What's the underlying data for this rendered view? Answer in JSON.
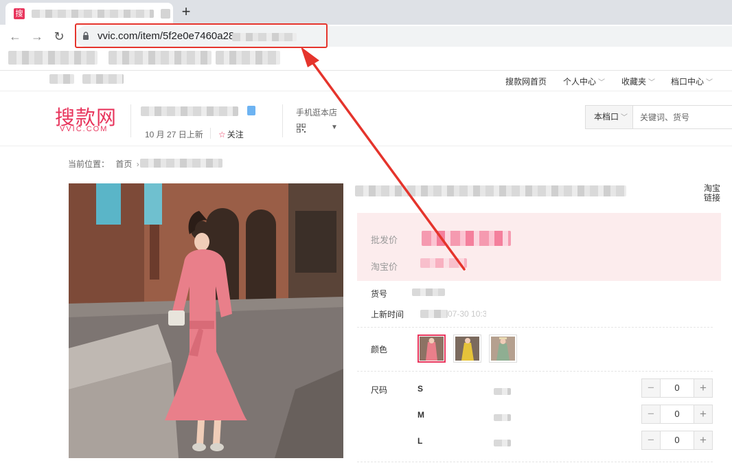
{
  "browser": {
    "tab_favicon_glyph": "搜",
    "new_tab_glyph": "+",
    "url": "vvic.com/item/5f2e0e7460a28",
    "highlight_color": "#e5342c"
  },
  "topnav": {
    "items": [
      {
        "label": "搜款网首页",
        "has_caret": false
      },
      {
        "label": "个人中心",
        "has_caret": true
      },
      {
        "label": "收藏夹",
        "has_caret": true
      },
      {
        "label": "档口中心",
        "has_caret": true
      }
    ],
    "caret_glyph": "﹀"
  },
  "header": {
    "logo_cn": "搜款网",
    "logo_en": "VVIC.COM",
    "brand_color": "#e8365d",
    "shop_date": "10 月 27 日上新",
    "follow_label": "关注",
    "mobile_store_label": "手机逛本店",
    "search_scope": "本档口",
    "search_placeholder": "关键词、货号"
  },
  "breadcrumb": {
    "prefix": "当前位置：",
    "home": "首页",
    "separator": "›"
  },
  "product": {
    "taobao_link": "淘宝链接",
    "wholesale_price_label": "批发价",
    "taobao_price_label": "淘宝价",
    "item_no_label": "货号",
    "listed_time_label": "上新时间",
    "listed_time_visible": "07-30 10:30",
    "color_label": "颜色",
    "size_label": "尺码",
    "sizes": [
      {
        "size": "S",
        "qty": "0"
      },
      {
        "size": "M",
        "qty": "0"
      },
      {
        "size": "L",
        "qty": "0"
      }
    ],
    "minus_glyph": "−",
    "plus_glyph": "+"
  }
}
